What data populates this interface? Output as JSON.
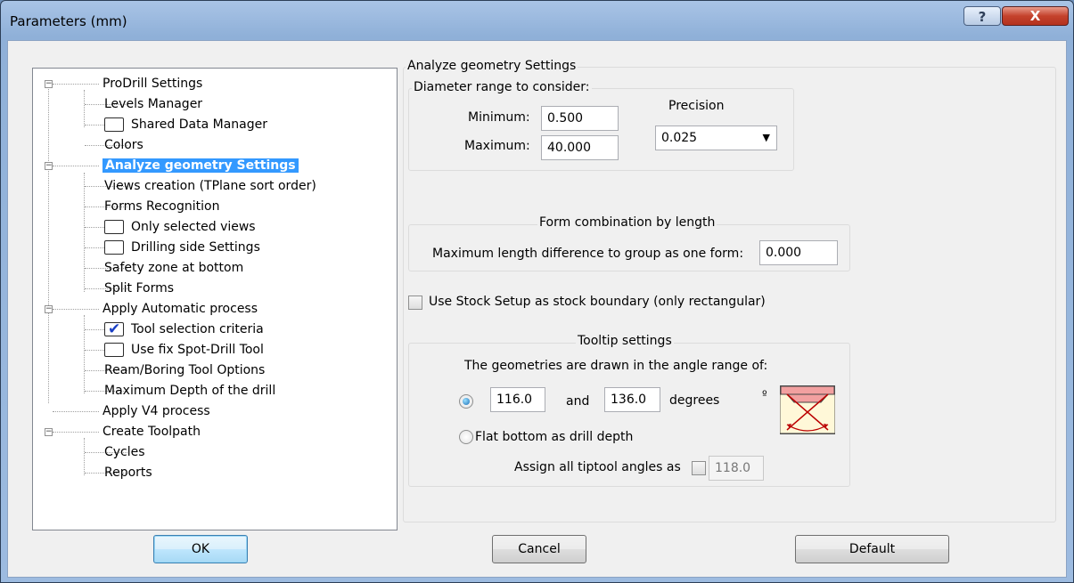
{
  "window": {
    "title": "Parameters (mm)",
    "help_glyph": "?",
    "close_glyph": "X"
  },
  "tree": [
    {
      "label": "ProDrill Settings",
      "level": 0,
      "expander": "−"
    },
    {
      "label": "Levels Manager",
      "level": 1
    },
    {
      "label": "Shared Data Manager",
      "level": 1,
      "checkbox": "unchecked"
    },
    {
      "label": "Colors",
      "level": 1
    },
    {
      "label": "Analyze geometry Settings",
      "level": 0,
      "expander": "−",
      "selected": true
    },
    {
      "label": "Views creation (TPlane sort order)",
      "level": 1
    },
    {
      "label": "Forms Recognition",
      "level": 1
    },
    {
      "label": "Only selected views",
      "level": 1,
      "checkbox": "unchecked"
    },
    {
      "label": "Drilling side Settings",
      "level": 1,
      "checkbox": "unchecked"
    },
    {
      "label": "Safety zone at bottom",
      "level": 1
    },
    {
      "label": "Split Forms",
      "level": 1
    },
    {
      "label": "Apply Automatic process",
      "level": 0,
      "expander": "−"
    },
    {
      "label": "Tool selection criteria",
      "level": 1,
      "checkbox": "checked"
    },
    {
      "label": "Use fix Spot-Drill Tool",
      "level": 1,
      "checkbox": "unchecked"
    },
    {
      "label": "Ream/Boring Tool Options",
      "level": 1
    },
    {
      "label": "Maximum Depth of the drill",
      "level": 1
    },
    {
      "label": "Apply V4 process",
      "level": 0
    },
    {
      "label": "Create Toolpath",
      "level": 0,
      "expander": "−"
    },
    {
      "label": "Cycles",
      "level": 1
    },
    {
      "label": "Reports",
      "level": 1
    }
  ],
  "panel": {
    "title": "Analyze geometry Settings",
    "diameter": {
      "title": "Diameter range to consider:",
      "min_label": "Minimum:",
      "min_value": "0.500",
      "max_label": "Maximum:",
      "max_value": "40.000",
      "precision_label": "Precision",
      "precision_value": "0.025"
    },
    "form_combo": {
      "title": "Form combination by length",
      "label": "Maximum length difference to group as one form:",
      "value": "0.000"
    },
    "stock": {
      "label": "Use Stock Setup as stock boundary (only rectangular)",
      "checked": false
    },
    "tooltip": {
      "title": "Tooltip settings",
      "angle_range_label": "The geometries are drawn in the angle range of:",
      "angle_from": "116.0",
      "and_label": "and",
      "angle_to": "136.0",
      "degrees_label": "degrees",
      "degree_symbol": "º",
      "flat_bottom_label": "Flat bottom as drill depth",
      "assign_label": "Assign all tiptool angles as",
      "assign_value": "118.0",
      "range_selected": true
    }
  },
  "buttons": {
    "ok": "OK",
    "cancel": "Cancel",
    "default": "Default"
  }
}
